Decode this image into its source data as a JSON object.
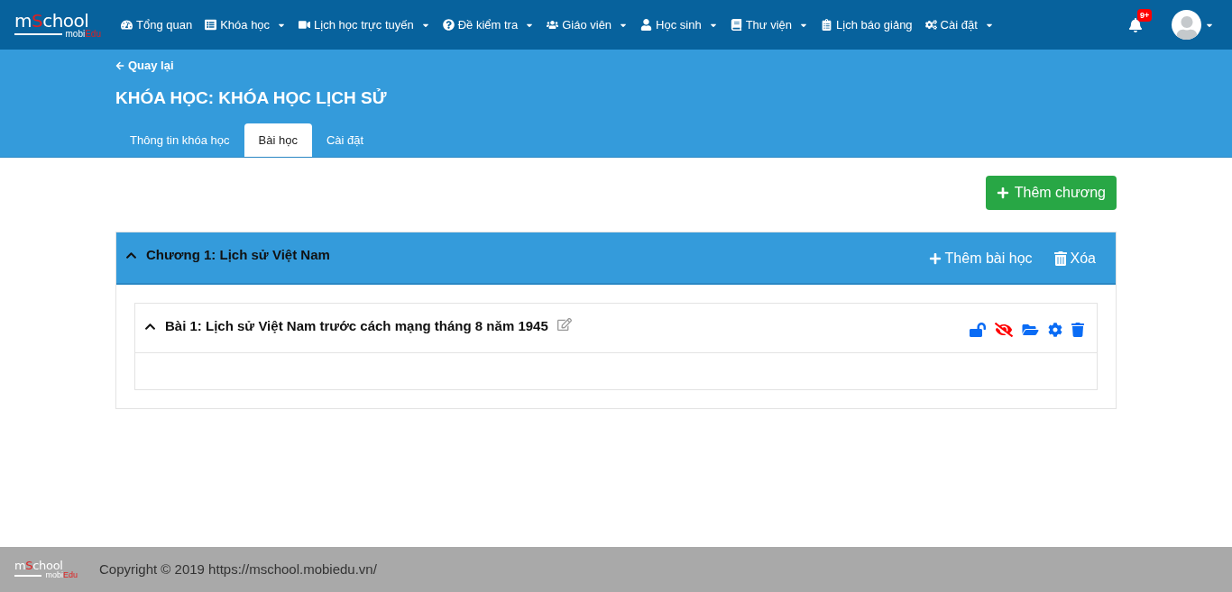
{
  "logo": {
    "main": "mSchool",
    "sub": "mobiEdu"
  },
  "nav": [
    {
      "label": "Tổng quan",
      "dropdown": false
    },
    {
      "label": "Khóa học",
      "dropdown": true
    },
    {
      "label": "Lịch học trực tuyến",
      "dropdown": true
    },
    {
      "label": "Đề kiểm tra",
      "dropdown": true
    },
    {
      "label": "Giáo viên",
      "dropdown": true
    },
    {
      "label": "Học sinh",
      "dropdown": true
    },
    {
      "label": "Thư viện",
      "dropdown": true
    },
    {
      "label": "Lịch báo giảng",
      "dropdown": false
    },
    {
      "label": "Cài đặt",
      "dropdown": true
    }
  ],
  "notifications": {
    "badge": "9+"
  },
  "header": {
    "back": "Quay lại",
    "title": "KHÓA HỌC: KHÓA HỌC LỊCH SỬ"
  },
  "tabs": [
    {
      "label": "Thông tin khóa học",
      "selected": false
    },
    {
      "label": "Bài học",
      "selected": true
    },
    {
      "label": "Cài đặt",
      "selected": false
    }
  ],
  "add_chapter": "Thêm chương",
  "chapters": [
    {
      "title": "Chương 1: Lịch sử Việt Nam",
      "expanded": true,
      "add_lesson": "Thêm bài học",
      "delete": "Xóa",
      "lessons": [
        {
          "title": "Bài 1: Lịch sử Việt Nam trước cách mạng tháng 8 năm 1945",
          "expanded": true
        }
      ]
    }
  ],
  "footer": {
    "logo": {
      "main": "mSchool",
      "sub": "mobiEdu"
    },
    "copyright": "Copyright © 2019 https://mschool.mobiedu.vn/"
  }
}
